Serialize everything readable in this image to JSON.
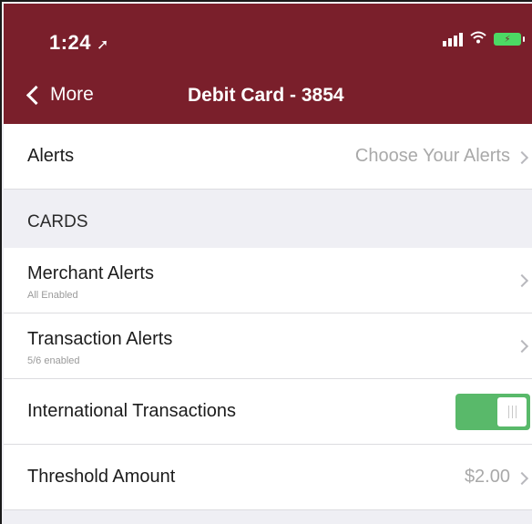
{
  "status_bar": {
    "time": "1:24",
    "location_icon": "location-arrow-icon",
    "signal_icon": "cellular-signal-icon",
    "wifi_icon": "wifi-icon",
    "battery_icon": "battery-charging-icon"
  },
  "nav": {
    "back_label": "More",
    "title": "Debit Card - 3854"
  },
  "alerts_row": {
    "label": "Alerts",
    "value": "Choose Your Alerts"
  },
  "section": {
    "label": "CARDS"
  },
  "rows": [
    {
      "label": "Merchant Alerts",
      "sublabel": "All Enabled"
    },
    {
      "label": "Transaction Alerts",
      "sublabel": "5/6 enabled"
    },
    {
      "label": "International Transactions",
      "toggle_on": true
    },
    {
      "label": "Threshold Amount",
      "value": "$2.00"
    }
  ],
  "colors": {
    "header": "#7a1f2b",
    "toggle_on": "#59b96a",
    "background": "#efeff4"
  }
}
